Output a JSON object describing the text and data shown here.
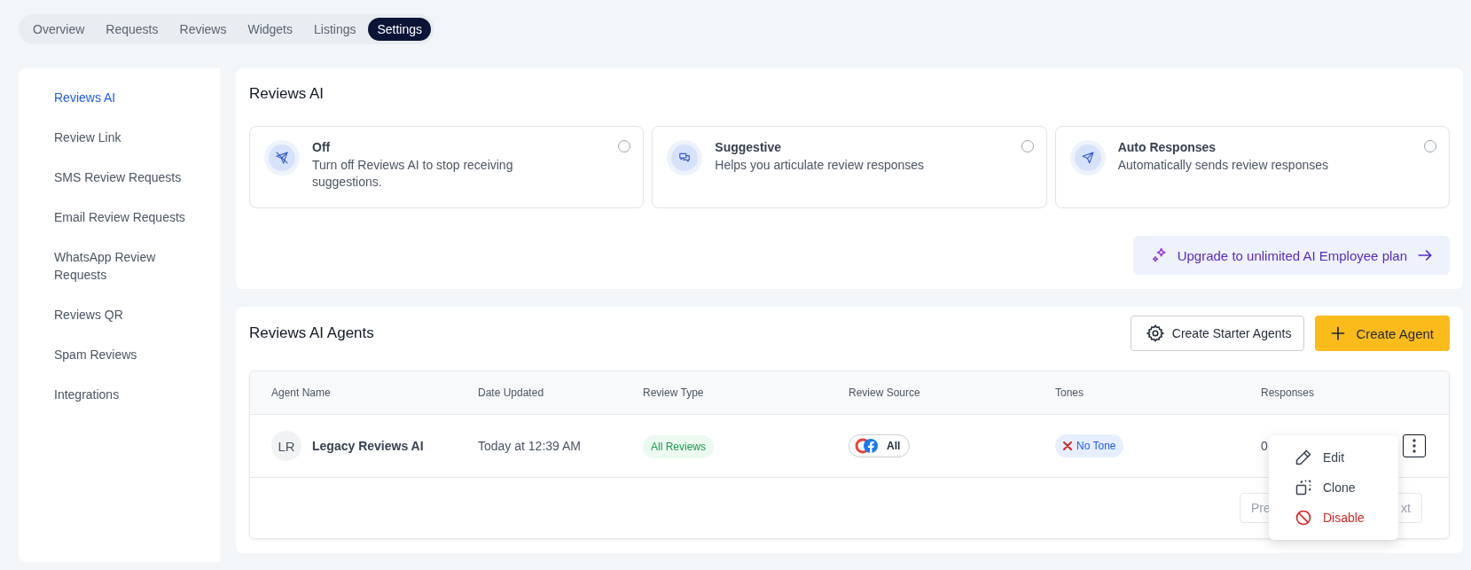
{
  "tabs": [
    {
      "label": "Overview",
      "selected": false
    },
    {
      "label": "Requests",
      "selected": false
    },
    {
      "label": "Reviews",
      "selected": false
    },
    {
      "label": "Widgets",
      "selected": false
    },
    {
      "label": "Listings",
      "selected": false
    },
    {
      "label": "Settings",
      "selected": true
    }
  ],
  "sidebar": {
    "items": [
      {
        "label": "Reviews AI",
        "selected": true
      },
      {
        "label": "Review Link",
        "selected": false
      },
      {
        "label": "SMS Review Requests",
        "selected": false
      },
      {
        "label": "Email Review Requests",
        "selected": false
      },
      {
        "label": "WhatsApp Review Requests",
        "selected": false
      },
      {
        "label": "Reviews QR",
        "selected": false
      },
      {
        "label": "Spam Reviews",
        "selected": false
      },
      {
        "label": "Integrations",
        "selected": false
      }
    ]
  },
  "reviews_ai": {
    "title": "Reviews AI",
    "options": [
      {
        "kind": "off",
        "title": "Off",
        "description": "Turn off Reviews AI to stop receiving suggestions.",
        "selected": false
      },
      {
        "kind": "suggestive",
        "title": "Suggestive",
        "description": "Helps you articulate review responses",
        "selected": false
      },
      {
        "kind": "auto",
        "title": "Auto Responses",
        "description": "Automatically sends review responses",
        "selected": false
      }
    ],
    "upgrade_button": "Upgrade to unlimited AI Employee plan"
  },
  "agents": {
    "title": "Reviews AI Agents",
    "starter_button": "Create Starter Agents",
    "create_button": "Create Agent",
    "table": {
      "columns": [
        "Agent Name",
        "Date Updated",
        "Review Type",
        "Review Source",
        "Tones",
        "Responses"
      ],
      "rows": [
        {
          "initials": "LR",
          "name": "Legacy Reviews AI",
          "date_updated": "Today at 12:39 AM",
          "review_type": "All Reviews",
          "review_source": "All",
          "tones": "No Tone",
          "responses": "0"
        }
      ]
    },
    "pagination": {
      "previous": "Pre",
      "next": "xt"
    },
    "row_menu": [
      {
        "kind": "edit",
        "label": "Edit"
      },
      {
        "kind": "clone",
        "label": "Clone"
      },
      {
        "kind": "disable",
        "label": "Disable"
      }
    ]
  }
}
